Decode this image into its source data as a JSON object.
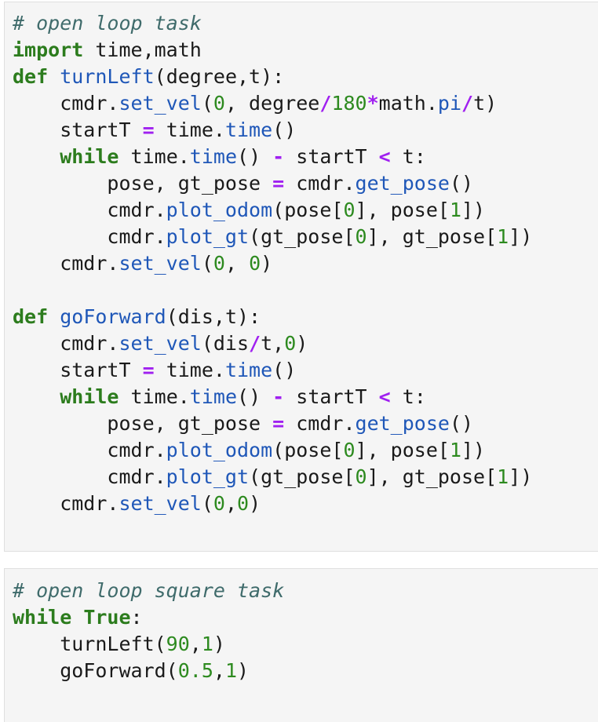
{
  "cells": [
    {
      "lines": [
        [
          {
            "t": "cm",
            "v": "# open loop task"
          }
        ],
        [
          {
            "t": "kw",
            "v": "import"
          },
          {
            "t": "tx",
            "v": " time,math"
          }
        ],
        [
          {
            "t": "kw",
            "v": "def"
          },
          {
            "t": "tx",
            "v": " "
          },
          {
            "t": "fn",
            "v": "turnLeft"
          },
          {
            "t": "tx",
            "v": "(degree,t):"
          }
        ],
        [
          {
            "t": "tx",
            "v": "    cmdr."
          },
          {
            "t": "at",
            "v": "set_vel"
          },
          {
            "t": "tx",
            "v": "("
          },
          {
            "t": "num",
            "v": "0"
          },
          {
            "t": "tx",
            "v": ", degree"
          },
          {
            "t": "op",
            "v": "/"
          },
          {
            "t": "num",
            "v": "180"
          },
          {
            "t": "op",
            "v": "*"
          },
          {
            "t": "tx",
            "v": "math."
          },
          {
            "t": "at",
            "v": "pi"
          },
          {
            "t": "op",
            "v": "/"
          },
          {
            "t": "tx",
            "v": "t)"
          }
        ],
        [
          {
            "t": "tx",
            "v": "    startT "
          },
          {
            "t": "op",
            "v": "="
          },
          {
            "t": "tx",
            "v": " time."
          },
          {
            "t": "at",
            "v": "time"
          },
          {
            "t": "tx",
            "v": "()"
          }
        ],
        [
          {
            "t": "tx",
            "v": "    "
          },
          {
            "t": "kw",
            "v": "while"
          },
          {
            "t": "tx",
            "v": " time."
          },
          {
            "t": "at",
            "v": "time"
          },
          {
            "t": "tx",
            "v": "() "
          },
          {
            "t": "op",
            "v": "-"
          },
          {
            "t": "tx",
            "v": " startT "
          },
          {
            "t": "op",
            "v": "<"
          },
          {
            "t": "tx",
            "v": " t:"
          }
        ],
        [
          {
            "t": "tx",
            "v": "        pose, gt_pose "
          },
          {
            "t": "op",
            "v": "="
          },
          {
            "t": "tx",
            "v": " cmdr."
          },
          {
            "t": "at",
            "v": "get_pose"
          },
          {
            "t": "tx",
            "v": "()"
          }
        ],
        [
          {
            "t": "tx",
            "v": "        cmdr."
          },
          {
            "t": "at",
            "v": "plot_odom"
          },
          {
            "t": "tx",
            "v": "(pose["
          },
          {
            "t": "num",
            "v": "0"
          },
          {
            "t": "tx",
            "v": "], pose["
          },
          {
            "t": "num",
            "v": "1"
          },
          {
            "t": "tx",
            "v": "])"
          }
        ],
        [
          {
            "t": "tx",
            "v": "        cmdr."
          },
          {
            "t": "at",
            "v": "plot_gt"
          },
          {
            "t": "tx",
            "v": "(gt_pose["
          },
          {
            "t": "num",
            "v": "0"
          },
          {
            "t": "tx",
            "v": "], gt_pose["
          },
          {
            "t": "num",
            "v": "1"
          },
          {
            "t": "tx",
            "v": "])"
          }
        ],
        [
          {
            "t": "tx",
            "v": "    cmdr."
          },
          {
            "t": "at",
            "v": "set_vel"
          },
          {
            "t": "tx",
            "v": "("
          },
          {
            "t": "num",
            "v": "0"
          },
          {
            "t": "tx",
            "v": ", "
          },
          {
            "t": "num",
            "v": "0"
          },
          {
            "t": "tx",
            "v": ")"
          }
        ],
        [],
        [
          {
            "t": "kw",
            "v": "def"
          },
          {
            "t": "tx",
            "v": " "
          },
          {
            "t": "fn",
            "v": "goForward"
          },
          {
            "t": "tx",
            "v": "(dis,t):"
          }
        ],
        [
          {
            "t": "tx",
            "v": "    cmdr."
          },
          {
            "t": "at",
            "v": "set_vel"
          },
          {
            "t": "tx",
            "v": "(dis"
          },
          {
            "t": "op",
            "v": "/"
          },
          {
            "t": "tx",
            "v": "t,"
          },
          {
            "t": "num",
            "v": "0"
          },
          {
            "t": "tx",
            "v": ")"
          }
        ],
        [
          {
            "t": "tx",
            "v": "    startT "
          },
          {
            "t": "op",
            "v": "="
          },
          {
            "t": "tx",
            "v": " time."
          },
          {
            "t": "at",
            "v": "time"
          },
          {
            "t": "tx",
            "v": "()"
          }
        ],
        [
          {
            "t": "tx",
            "v": "    "
          },
          {
            "t": "kw",
            "v": "while"
          },
          {
            "t": "tx",
            "v": " time."
          },
          {
            "t": "at",
            "v": "time"
          },
          {
            "t": "tx",
            "v": "() "
          },
          {
            "t": "op",
            "v": "-"
          },
          {
            "t": "tx",
            "v": " startT "
          },
          {
            "t": "op",
            "v": "<"
          },
          {
            "t": "tx",
            "v": " t:"
          }
        ],
        [
          {
            "t": "tx",
            "v": "        pose, gt_pose "
          },
          {
            "t": "op",
            "v": "="
          },
          {
            "t": "tx",
            "v": " cmdr."
          },
          {
            "t": "at",
            "v": "get_pose"
          },
          {
            "t": "tx",
            "v": "()"
          }
        ],
        [
          {
            "t": "tx",
            "v": "        cmdr."
          },
          {
            "t": "at",
            "v": "plot_odom"
          },
          {
            "t": "tx",
            "v": "(pose["
          },
          {
            "t": "num",
            "v": "0"
          },
          {
            "t": "tx",
            "v": "], pose["
          },
          {
            "t": "num",
            "v": "1"
          },
          {
            "t": "tx",
            "v": "])"
          }
        ],
        [
          {
            "t": "tx",
            "v": "        cmdr."
          },
          {
            "t": "at",
            "v": "plot_gt"
          },
          {
            "t": "tx",
            "v": "(gt_pose["
          },
          {
            "t": "num",
            "v": "0"
          },
          {
            "t": "tx",
            "v": "], gt_pose["
          },
          {
            "t": "num",
            "v": "1"
          },
          {
            "t": "tx",
            "v": "])"
          }
        ],
        [
          {
            "t": "tx",
            "v": "    cmdr."
          },
          {
            "t": "at",
            "v": "set_vel"
          },
          {
            "t": "tx",
            "v": "("
          },
          {
            "t": "num",
            "v": "0"
          },
          {
            "t": "tx",
            "v": ","
          },
          {
            "t": "num",
            "v": "0"
          },
          {
            "t": "tx",
            "v": ")"
          }
        ]
      ]
    },
    {
      "lines": [
        [
          {
            "t": "cm",
            "v": "# open loop square task"
          }
        ],
        [
          {
            "t": "kw",
            "v": "while"
          },
          {
            "t": "tx",
            "v": " "
          },
          {
            "t": "kw",
            "v": "True"
          },
          {
            "t": "tx",
            "v": ":"
          }
        ],
        [
          {
            "t": "tx",
            "v": "    turnLeft("
          },
          {
            "t": "num",
            "v": "90"
          },
          {
            "t": "tx",
            "v": ","
          },
          {
            "t": "num",
            "v": "1"
          },
          {
            "t": "tx",
            "v": ")"
          }
        ],
        [
          {
            "t": "tx",
            "v": "    goForward("
          },
          {
            "t": "num",
            "v": "0.5"
          },
          {
            "t": "tx",
            "v": ","
          },
          {
            "t": "num",
            "v": "1"
          },
          {
            "t": "tx",
            "v": ")"
          }
        ]
      ]
    }
  ],
  "colors": {
    "cell_background": "#f5f5f5",
    "cell_border": "#dfdfdf",
    "comment": "#3f6b6b",
    "keyword": "#2c7c1d",
    "function_name": "#1f57b8",
    "number": "#2d8a1f",
    "operator": "#a020f0",
    "text": "#1a1a1a"
  }
}
